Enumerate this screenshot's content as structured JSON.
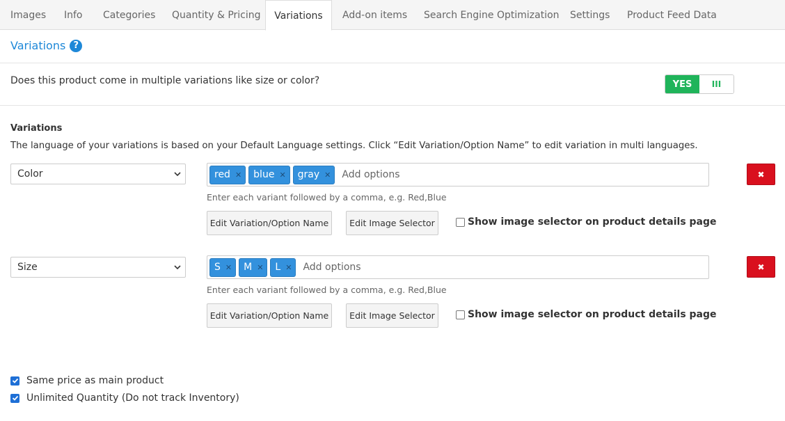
{
  "tabs": [
    {
      "label": "Images"
    },
    {
      "label": "Info"
    },
    {
      "label": "Categories"
    },
    {
      "label": "Quantity & Pricing"
    },
    {
      "label": "Variations"
    },
    {
      "label": "Add-on items"
    },
    {
      "label": "Search Engine Optimization"
    },
    {
      "label": "Settings"
    },
    {
      "label": "Product Feed Data"
    }
  ],
  "active_tab": "Variations",
  "section": {
    "title": "Variations",
    "help": "?"
  },
  "multi": {
    "question": "Does this product come in multiple variations like size or color?",
    "toggle_label": "YES",
    "toggle_handle": "III"
  },
  "variations": {
    "heading": "Variations",
    "description": "The language of your variations is based on your Default Language settings. Click “Edit Variation/Option Name” to edit variation in multi languages.",
    "rows": [
      {
        "name": "Color",
        "tags": [
          "red",
          "blue",
          "gray"
        ],
        "placeholder": "Add options",
        "hint": "Enter each variant followed by a comma, e.g. Red,Blue",
        "edit_name_label": "Edit Variation/Option Name",
        "edit_image_label": "Edit Image Selector",
        "show_image_label": "Show image selector on product details page",
        "remove": "✖"
      },
      {
        "name": "Size",
        "tags": [
          "S",
          "M",
          "L"
        ],
        "placeholder": "Add options",
        "hint": "Enter each variant followed by a comma, e.g. Red,Blue",
        "edit_name_label": "Edit Variation/Option Name",
        "edit_image_label": "Edit Image Selector",
        "show_image_label": "Show image selector on product details page",
        "remove": "✖"
      }
    ]
  },
  "options": {
    "same_price": "Same price as main product",
    "unlimited_qty": "Unlimited Quantity (Do not track Inventory)"
  },
  "colors": {
    "accent": "#1e88d8",
    "toggle_green": "#1fb45a",
    "danger": "#d9101e",
    "tag_blue": "#3391dd"
  }
}
